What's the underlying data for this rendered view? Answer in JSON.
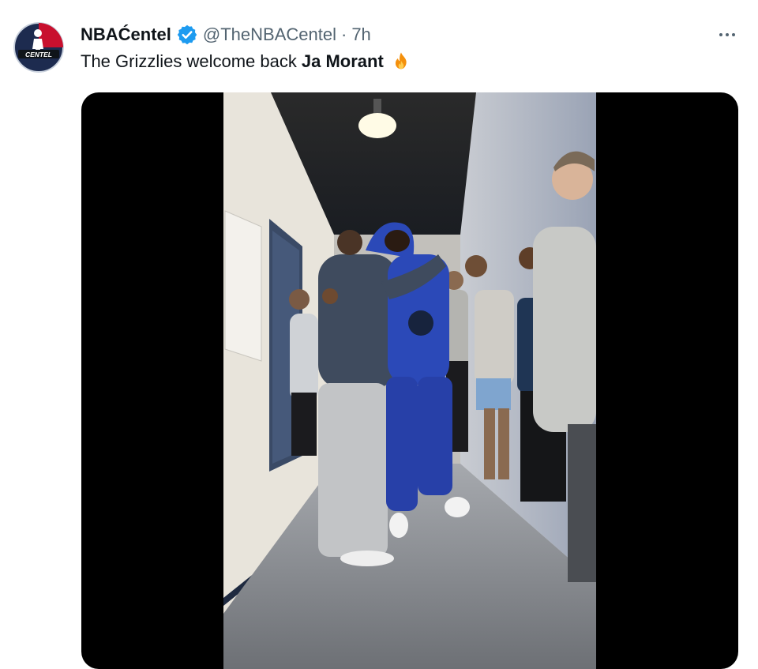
{
  "tweet": {
    "author": {
      "display_name": "NBAĆentel",
      "handle": "@TheNBACentel",
      "avatar_text": "CENTEL",
      "verified": true
    },
    "separator": "·",
    "time": "7h",
    "text_prefix": "The Grizzlies welcome back",
    "mention": "Ja Morant",
    "emoji": "fire-icon",
    "more_menu_icon": "more-horizontal-icon"
  },
  "media": {
    "type": "video",
    "description_icon": "video-player"
  },
  "colors": {
    "verified_blue": "#1d9bf0",
    "text_primary": "#0f1419",
    "text_secondary": "#536471",
    "avatar_red": "#c8102e",
    "avatar_navy": "#1d2b4f"
  }
}
